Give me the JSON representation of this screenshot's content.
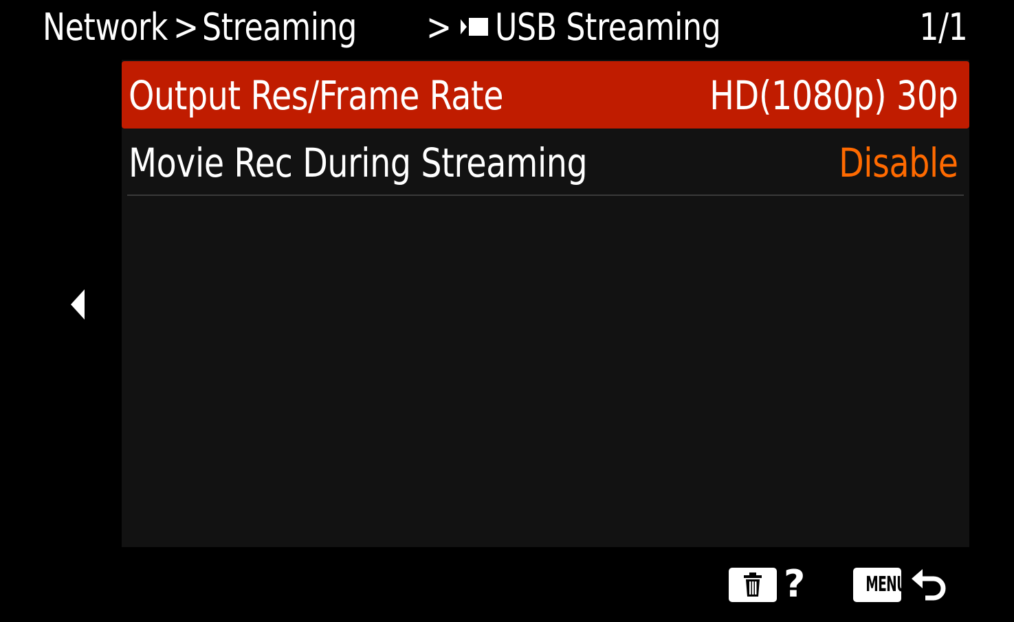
{
  "header": {
    "breadcrumb": [
      "Network",
      "Streaming",
      "USB Streaming"
    ],
    "separator": ">",
    "page_indicator": "1/1"
  },
  "menu": {
    "items": [
      {
        "label": "Output Res/Frame Rate",
        "value": "HD(1080p) 30p",
        "selected": true
      },
      {
        "label": "Movie Rec During Streaming",
        "value": "Disable",
        "selected": false
      }
    ]
  },
  "footer": {
    "help_label": "?",
    "menu_label": "MENU"
  },
  "colors": {
    "background": "#000000",
    "panel": "#121212",
    "selection": "#c01c00",
    "value_highlight": "#ff6a00"
  },
  "icons": [
    "movie-mode-icon",
    "left-arrow-icon",
    "trash-icon",
    "help-icon",
    "menu-button-icon",
    "return-icon"
  ]
}
